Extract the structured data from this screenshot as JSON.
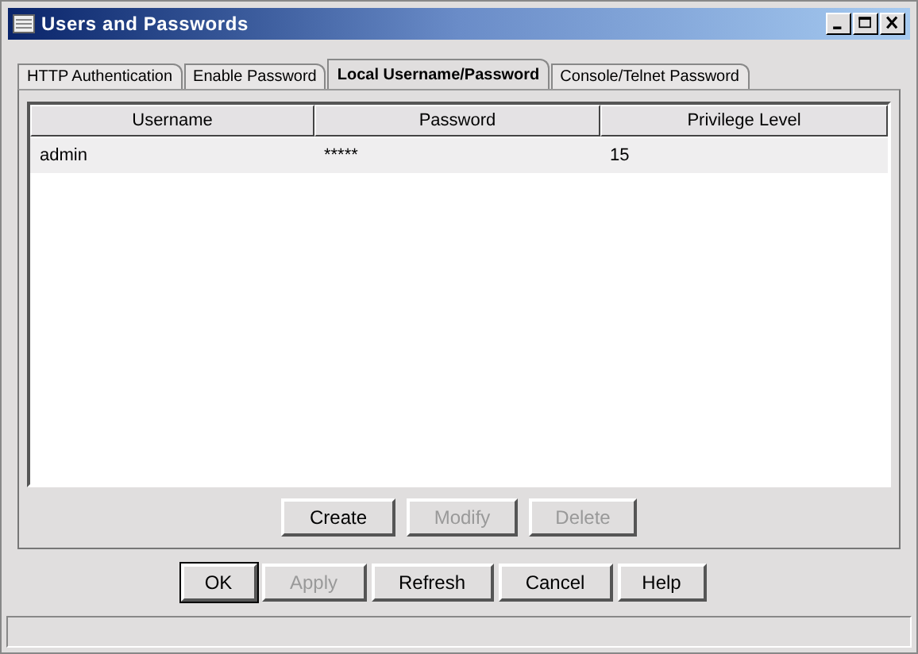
{
  "window": {
    "title": "Users and Passwords"
  },
  "tabs": [
    {
      "label": "HTTP Authentication",
      "selected": false
    },
    {
      "label": "Enable Password",
      "selected": false
    },
    {
      "label": "Local Username/Password",
      "selected": true
    },
    {
      "label": "Console/Telnet Password",
      "selected": false
    }
  ],
  "table": {
    "columns": [
      "Username",
      "Password",
      "Privilege Level"
    ],
    "rows": [
      {
        "cells": [
          "admin",
          "*****",
          "15"
        ],
        "selected": true
      }
    ]
  },
  "table_buttons": [
    {
      "label": "Create",
      "disabled": false
    },
    {
      "label": "Modify",
      "disabled": true
    },
    {
      "label": "Delete",
      "disabled": true
    }
  ],
  "dialog_buttons": [
    {
      "label": "OK",
      "disabled": false,
      "default": true
    },
    {
      "label": "Apply",
      "disabled": true,
      "default": false
    },
    {
      "label": "Refresh",
      "disabled": false,
      "default": false
    },
    {
      "label": "Cancel",
      "disabled": false,
      "default": false
    },
    {
      "label": "Help",
      "disabled": false,
      "default": false
    }
  ]
}
